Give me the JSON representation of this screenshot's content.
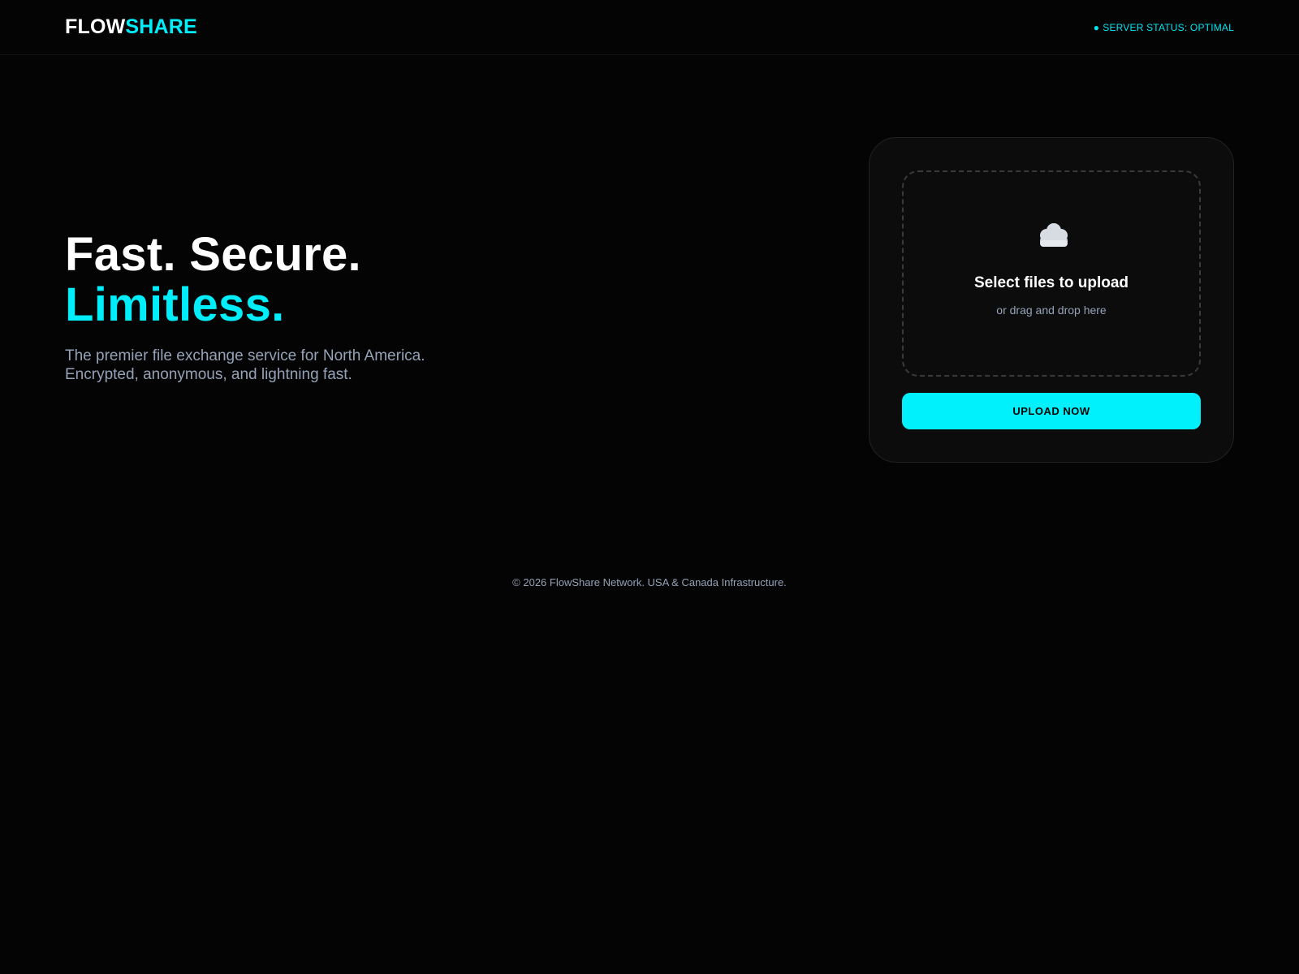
{
  "header": {
    "logo_part1": "FLOW",
    "logo_part2": "SHARE",
    "status_dot": "●",
    "status_text": "SERVER STATUS: OPTIMAL"
  },
  "hero": {
    "headline_line1": "Fast. Secure.",
    "headline_line2": "Limitless.",
    "subtitle_line1": "The premier file exchange service for North America.",
    "subtitle_line2": "Encrypted, anonymous, and lightning fast."
  },
  "upload": {
    "icon": "cloud-icon",
    "title": "Select files to upload",
    "subtitle": "or drag and drop here",
    "button_label": "UPLOAD NOW"
  },
  "footer": {
    "text": "© 2026 FlowShare Network. USA & Canada Infrastructure."
  },
  "colors": {
    "accent": "#00eefa",
    "background": "#040404",
    "card": "#0c0c0c",
    "muted": "#94a3b8"
  }
}
